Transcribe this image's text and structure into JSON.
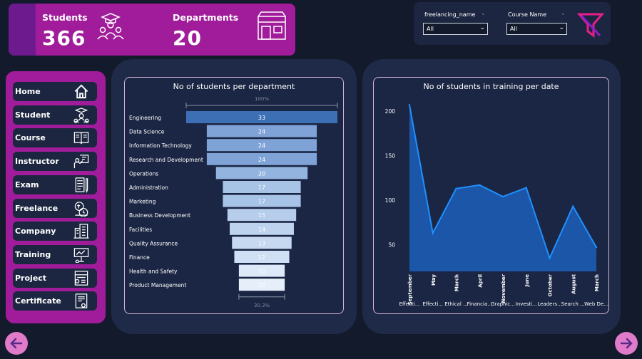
{
  "kpis": {
    "students": {
      "label": "Students",
      "value": "366"
    },
    "departments": {
      "label": "Departments",
      "value": "20"
    }
  },
  "filters": {
    "freelancing": {
      "label": "freelancing_name",
      "value": "All"
    },
    "course": {
      "label": "Course Name",
      "value": "All"
    }
  },
  "nav": {
    "items": [
      {
        "label": "Home",
        "icon": "home-icon"
      },
      {
        "label": "Student",
        "icon": "students-icon"
      },
      {
        "label": "Course",
        "icon": "book-icon"
      },
      {
        "label": "Instructor",
        "icon": "teacher-icon"
      },
      {
        "label": "Exam",
        "icon": "exam-icon"
      },
      {
        "label": "Freelance",
        "icon": "freelance-icon"
      },
      {
        "label": "Company",
        "icon": "building-icon"
      },
      {
        "label": "Training",
        "icon": "training-icon"
      },
      {
        "label": "Project",
        "icon": "project-icon"
      },
      {
        "label": "Certificate",
        "icon": "certificate-icon"
      }
    ]
  },
  "colors": {
    "accent": "#a11c9a",
    "panel": "#1c2640",
    "background": "#121a2b",
    "line": "#1e90ff",
    "area": "#1c56a8"
  },
  "chart_data": [
    {
      "type": "bar",
      "subtype": "funnel",
      "title": "No of students per department",
      "top_percent_label": "100%",
      "bottom_percent_label": "30.3%",
      "categories": [
        "Engineering",
        "Data Science",
        "Information Technology",
        "Research and Development",
        "Operations",
        "Administration",
        "Marketing",
        "Business Development",
        "Facilities",
        "Quality Assurance",
        "Finance",
        "Health and Safety",
        "Product Management"
      ],
      "values": [
        33,
        24,
        24,
        24,
        20,
        17,
        17,
        15,
        14,
        13,
        12,
        10,
        10
      ],
      "colors": [
        "#3d6fb5",
        "#7fa3d6",
        "#7fa3d6",
        "#7fa3d6",
        "#93b4de",
        "#a7c3e6",
        "#a7c3e6",
        "#b6cdeb",
        "#bdd3ee",
        "#c6d9f1",
        "#cfdff4",
        "#dde8f8",
        "#e6eefa"
      ]
    },
    {
      "type": "area",
      "title": "No of students in training per date",
      "categories": [
        "September",
        "May",
        "March",
        "April",
        "November",
        "June",
        "October",
        "August",
        "March"
      ],
      "group_labels": [
        "Effecti...",
        "Effecti...",
        "Ethical ...",
        "Financia...",
        "Graphic...",
        "Investi...",
        "Leaders...",
        "Search ...",
        "Web De..."
      ],
      "values": [
        207,
        63,
        113,
        117,
        104,
        114,
        35,
        93,
        47
      ],
      "yticks": [
        50,
        100,
        150,
        200
      ],
      "ylim": [
        20,
        220
      ]
    }
  ]
}
